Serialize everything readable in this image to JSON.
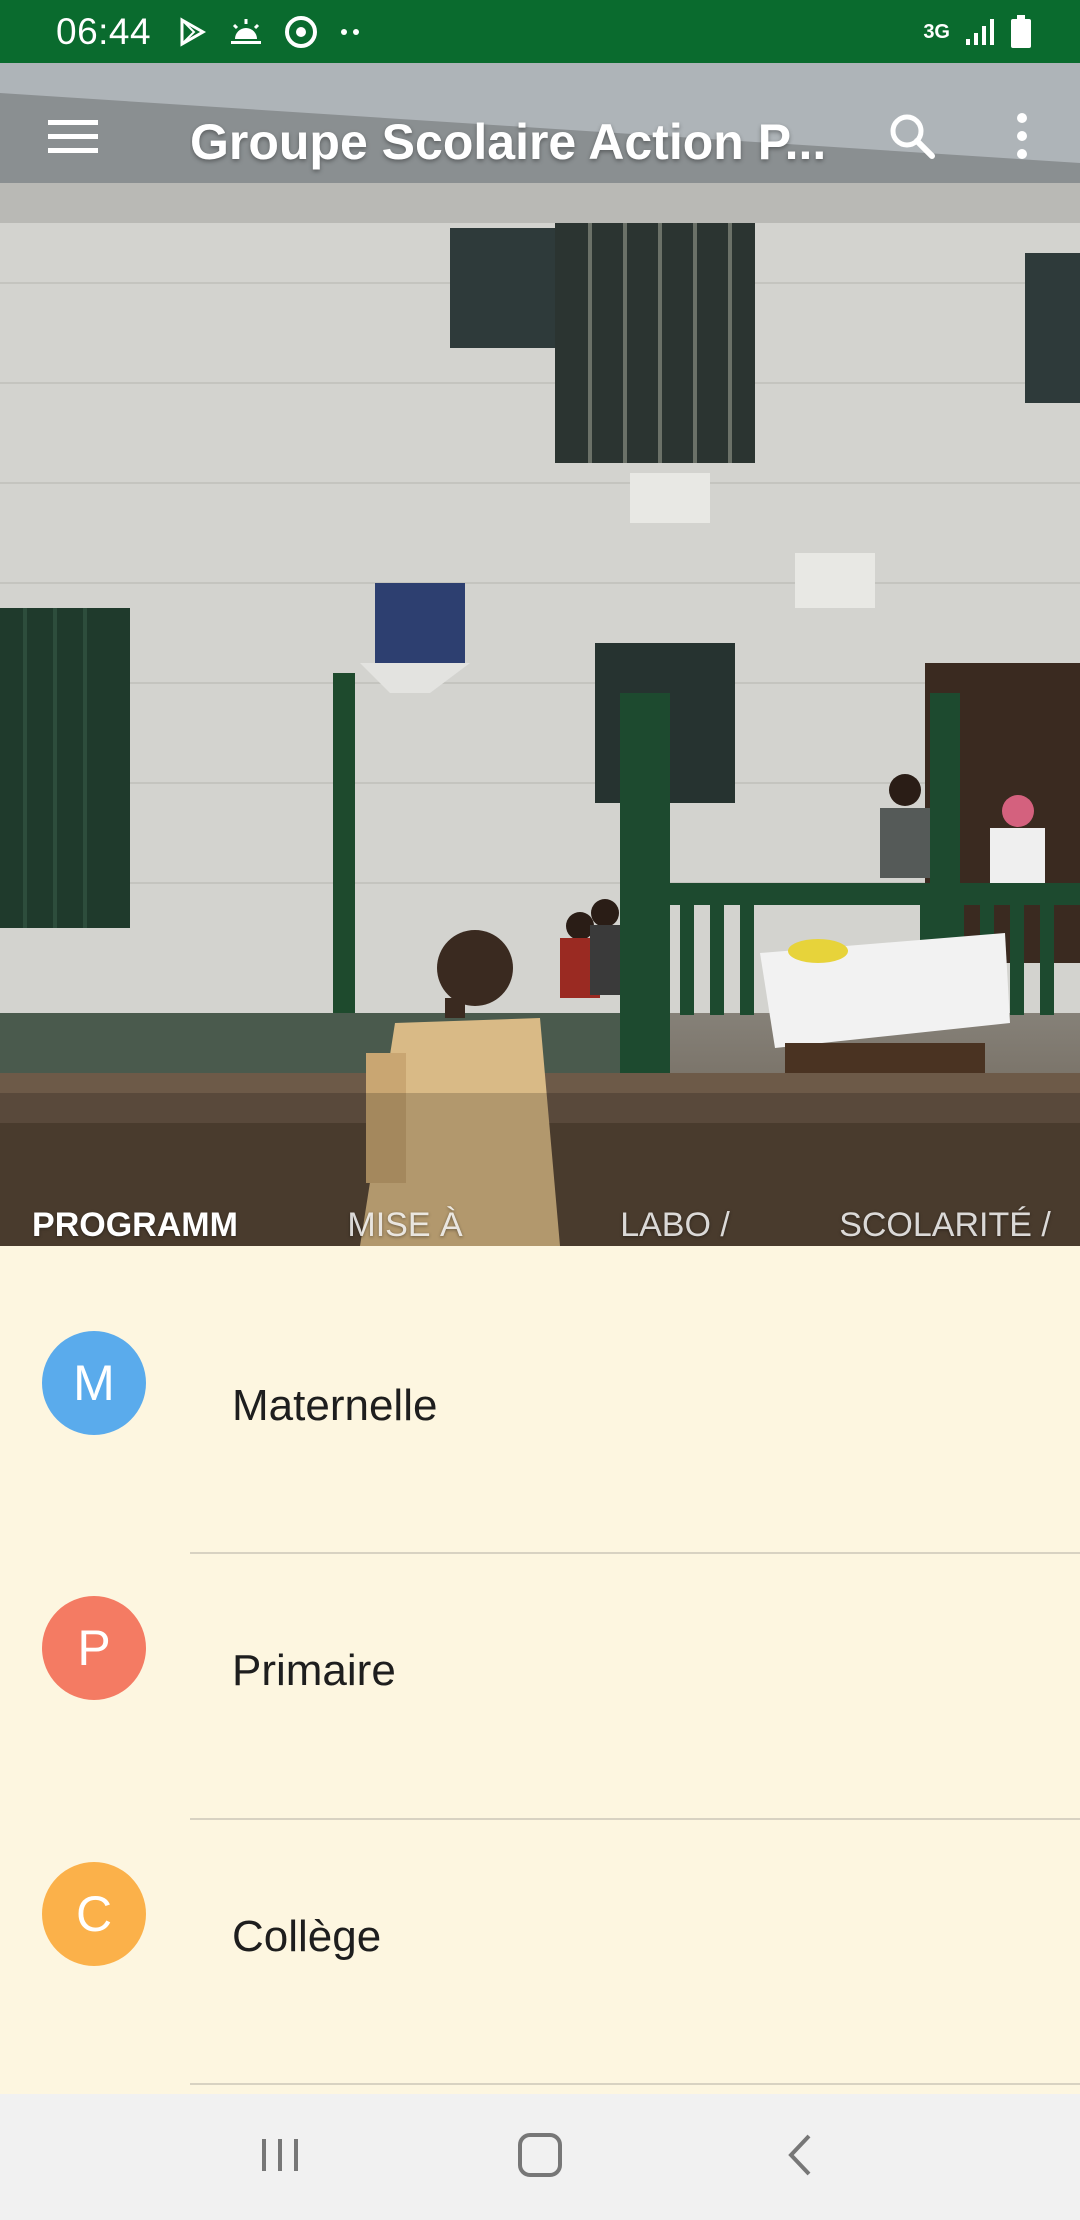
{
  "status_bar": {
    "time": "06:44",
    "network": "3G"
  },
  "toolbar": {
    "title": "Groupe Scolaire Action P...",
    "menu_icon": "hamburger-menu-icon",
    "search_icon": "search-icon",
    "more_icon": "more-vert-icon"
  },
  "tabs": [
    {
      "label": "PROGRAMM E",
      "active": true
    },
    {
      "label": "MISE À NIVEAU",
      "active": false
    },
    {
      "label": "LABO / SALLES",
      "active": false
    },
    {
      "label": "SCOLARITÉ / INFORMA...",
      "active": false
    }
  ],
  "list": [
    {
      "initial": "M",
      "label": "Maternelle",
      "color": "#5aabec"
    },
    {
      "initial": "P",
      "label": "Primaire",
      "color": "#f47b63"
    },
    {
      "initial": "C",
      "label": "Collège",
      "color": "#fbb14a"
    }
  ],
  "colors": {
    "status_bar": "#0a6b2e",
    "list_background": "#fdf6e0",
    "nav_background": "#f1f1f1"
  }
}
